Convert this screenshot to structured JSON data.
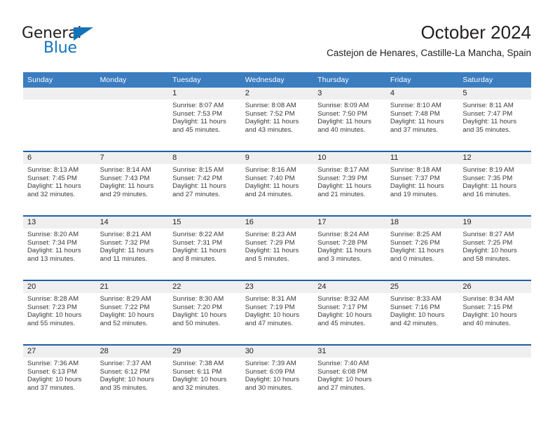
{
  "brand": {
    "name_part1": "General",
    "name_part2": "Blue",
    "accent_color": "#1273b9"
  },
  "header": {
    "title": "October 2024",
    "subtitle": "Castejon de Henares, Castille-La Mancha, Spain"
  },
  "theme": {
    "header_blue": "#3c7dc0",
    "rule_blue": "#1f5fa8",
    "daynum_band": "#efefef"
  },
  "weekdays": [
    "Sunday",
    "Monday",
    "Tuesday",
    "Wednesday",
    "Thursday",
    "Friday",
    "Saturday"
  ],
  "weeks": [
    [
      {
        "day": "",
        "lines": []
      },
      {
        "day": "",
        "lines": []
      },
      {
        "day": "1",
        "lines": [
          "Sunrise: 8:07 AM",
          "Sunset: 7:53 PM",
          "Daylight: 11 hours",
          "and 45 minutes."
        ]
      },
      {
        "day": "2",
        "lines": [
          "Sunrise: 8:08 AM",
          "Sunset: 7:52 PM",
          "Daylight: 11 hours",
          "and 43 minutes."
        ]
      },
      {
        "day": "3",
        "lines": [
          "Sunrise: 8:09 AM",
          "Sunset: 7:50 PM",
          "Daylight: 11 hours",
          "and 40 minutes."
        ]
      },
      {
        "day": "4",
        "lines": [
          "Sunrise: 8:10 AM",
          "Sunset: 7:48 PM",
          "Daylight: 11 hours",
          "and 37 minutes."
        ]
      },
      {
        "day": "5",
        "lines": [
          "Sunrise: 8:11 AM",
          "Sunset: 7:47 PM",
          "Daylight: 11 hours",
          "and 35 minutes."
        ]
      }
    ],
    [
      {
        "day": "6",
        "lines": [
          "Sunrise: 8:13 AM",
          "Sunset: 7:45 PM",
          "Daylight: 11 hours",
          "and 32 minutes."
        ]
      },
      {
        "day": "7",
        "lines": [
          "Sunrise: 8:14 AM",
          "Sunset: 7:43 PM",
          "Daylight: 11 hours",
          "and 29 minutes."
        ]
      },
      {
        "day": "8",
        "lines": [
          "Sunrise: 8:15 AM",
          "Sunset: 7:42 PM",
          "Daylight: 11 hours",
          "and 27 minutes."
        ]
      },
      {
        "day": "9",
        "lines": [
          "Sunrise: 8:16 AM",
          "Sunset: 7:40 PM",
          "Daylight: 11 hours",
          "and 24 minutes."
        ]
      },
      {
        "day": "10",
        "lines": [
          "Sunrise: 8:17 AM",
          "Sunset: 7:39 PM",
          "Daylight: 11 hours",
          "and 21 minutes."
        ]
      },
      {
        "day": "11",
        "lines": [
          "Sunrise: 8:18 AM",
          "Sunset: 7:37 PM",
          "Daylight: 11 hours",
          "and 19 minutes."
        ]
      },
      {
        "day": "12",
        "lines": [
          "Sunrise: 8:19 AM",
          "Sunset: 7:35 PM",
          "Daylight: 11 hours",
          "and 16 minutes."
        ]
      }
    ],
    [
      {
        "day": "13",
        "lines": [
          "Sunrise: 8:20 AM",
          "Sunset: 7:34 PM",
          "Daylight: 11 hours",
          "and 13 minutes."
        ]
      },
      {
        "day": "14",
        "lines": [
          "Sunrise: 8:21 AM",
          "Sunset: 7:32 PM",
          "Daylight: 11 hours",
          "and 11 minutes."
        ]
      },
      {
        "day": "15",
        "lines": [
          "Sunrise: 8:22 AM",
          "Sunset: 7:31 PM",
          "Daylight: 11 hours",
          "and 8 minutes."
        ]
      },
      {
        "day": "16",
        "lines": [
          "Sunrise: 8:23 AM",
          "Sunset: 7:29 PM",
          "Daylight: 11 hours",
          "and 5 minutes."
        ]
      },
      {
        "day": "17",
        "lines": [
          "Sunrise: 8:24 AM",
          "Sunset: 7:28 PM",
          "Daylight: 11 hours",
          "and 3 minutes."
        ]
      },
      {
        "day": "18",
        "lines": [
          "Sunrise: 8:25 AM",
          "Sunset: 7:26 PM",
          "Daylight: 11 hours",
          "and 0 minutes."
        ]
      },
      {
        "day": "19",
        "lines": [
          "Sunrise: 8:27 AM",
          "Sunset: 7:25 PM",
          "Daylight: 10 hours",
          "and 58 minutes."
        ]
      }
    ],
    [
      {
        "day": "20",
        "lines": [
          "Sunrise: 8:28 AM",
          "Sunset: 7:23 PM",
          "Daylight: 10 hours",
          "and 55 minutes."
        ]
      },
      {
        "day": "21",
        "lines": [
          "Sunrise: 8:29 AM",
          "Sunset: 7:22 PM",
          "Daylight: 10 hours",
          "and 52 minutes."
        ]
      },
      {
        "day": "22",
        "lines": [
          "Sunrise: 8:30 AM",
          "Sunset: 7:20 PM",
          "Daylight: 10 hours",
          "and 50 minutes."
        ]
      },
      {
        "day": "23",
        "lines": [
          "Sunrise: 8:31 AM",
          "Sunset: 7:19 PM",
          "Daylight: 10 hours",
          "and 47 minutes."
        ]
      },
      {
        "day": "24",
        "lines": [
          "Sunrise: 8:32 AM",
          "Sunset: 7:17 PM",
          "Daylight: 10 hours",
          "and 45 minutes."
        ]
      },
      {
        "day": "25",
        "lines": [
          "Sunrise: 8:33 AM",
          "Sunset: 7:16 PM",
          "Daylight: 10 hours",
          "and 42 minutes."
        ]
      },
      {
        "day": "26",
        "lines": [
          "Sunrise: 8:34 AM",
          "Sunset: 7:15 PM",
          "Daylight: 10 hours",
          "and 40 minutes."
        ]
      }
    ],
    [
      {
        "day": "27",
        "lines": [
          "Sunrise: 7:36 AM",
          "Sunset: 6:13 PM",
          "Daylight: 10 hours",
          "and 37 minutes."
        ]
      },
      {
        "day": "28",
        "lines": [
          "Sunrise: 7:37 AM",
          "Sunset: 6:12 PM",
          "Daylight: 10 hours",
          "and 35 minutes."
        ]
      },
      {
        "day": "29",
        "lines": [
          "Sunrise: 7:38 AM",
          "Sunset: 6:11 PM",
          "Daylight: 10 hours",
          "and 32 minutes."
        ]
      },
      {
        "day": "30",
        "lines": [
          "Sunrise: 7:39 AM",
          "Sunset: 6:09 PM",
          "Daylight: 10 hours",
          "and 30 minutes."
        ]
      },
      {
        "day": "31",
        "lines": [
          "Sunrise: 7:40 AM",
          "Sunset: 6:08 PM",
          "Daylight: 10 hours",
          "and 27 minutes."
        ]
      },
      {
        "day": "",
        "lines": []
      },
      {
        "day": "",
        "lines": []
      }
    ]
  ]
}
